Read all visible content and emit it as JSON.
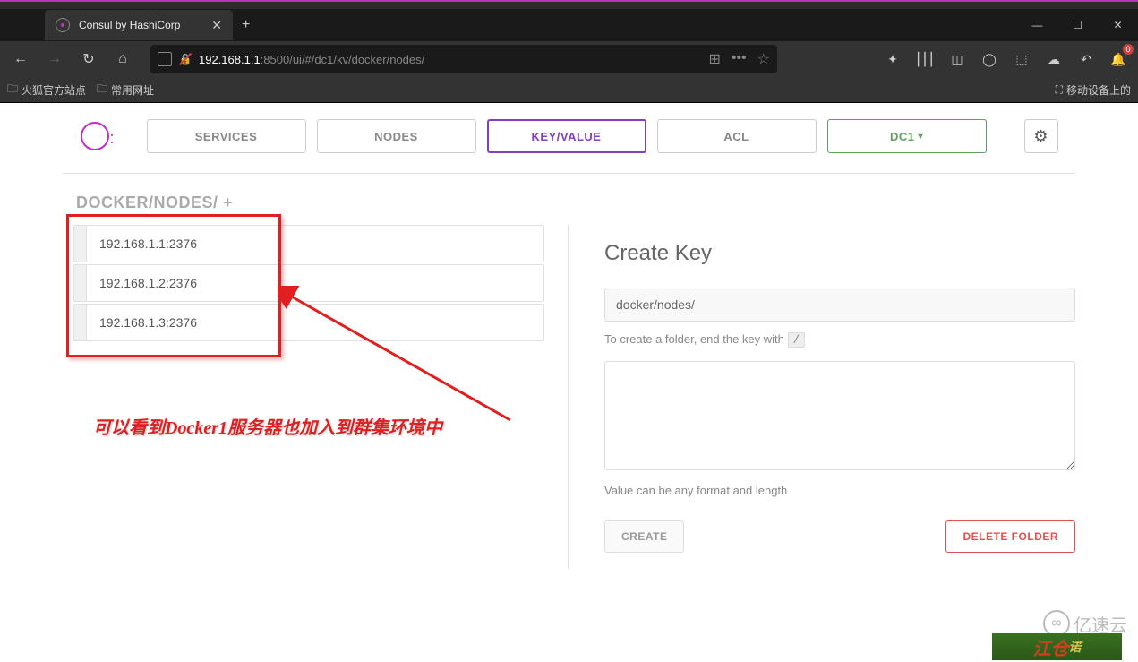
{
  "browser": {
    "tab_title": "Consul by HashiCorp",
    "url_host": "192.168.1.1",
    "url_path": ":8500/ui/#/dc1/kv/docker/nodes/",
    "bookmarks": {
      "firefox_official": "火狐官方站点",
      "common_sites": "常用网址",
      "mobile_devices": "移动设备上的"
    },
    "notification_count": "0"
  },
  "consul": {
    "nav": {
      "services": "SERVICES",
      "nodes": "NODES",
      "keyvalue": "KEY/VALUE",
      "acl": "ACL",
      "datacenter": "DC1"
    },
    "breadcrumb": {
      "part1": "DOCKER/",
      "part2": "NODES/",
      "add": " +"
    },
    "kv_items": [
      "192.168.1.1:2376",
      "192.168.1.2:2376",
      "192.168.1.3:2376"
    ],
    "create_panel": {
      "title": "Create Key",
      "key_value": "docker/nodes/",
      "folder_hint": "To create a folder, end the key with ",
      "slash": "/",
      "value_hint": "Value can be any format and length",
      "create_btn": "CREATE",
      "delete_btn": "DELETE FOLDER"
    }
  },
  "annotation": {
    "text": "可以看到Docker1服务器也加入到群集环境中"
  },
  "watermark": {
    "logo_text": "亿速云",
    "badge_red": "江仓",
    "badge_gold": "诺"
  }
}
